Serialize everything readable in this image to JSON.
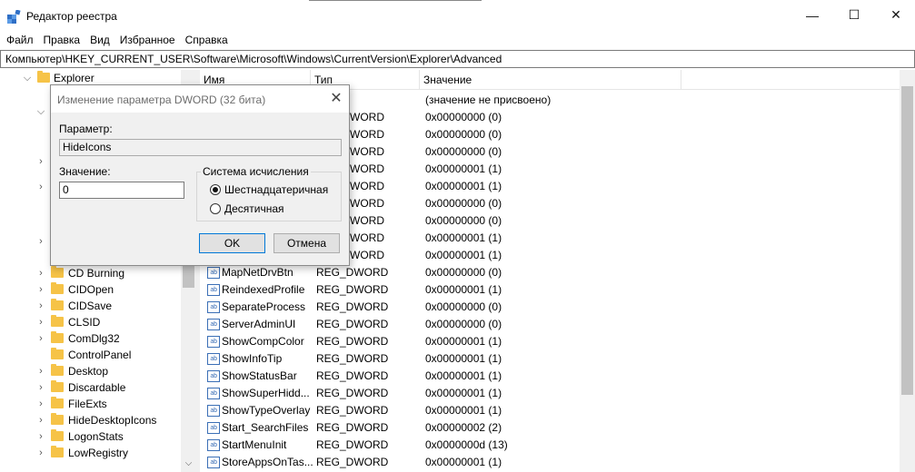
{
  "window": {
    "title": "Редактор реестра",
    "minimize": "—",
    "maximize": "☐",
    "close": "✕"
  },
  "menu": [
    "Файл",
    "Правка",
    "Вид",
    "Избранное",
    "Справка"
  ],
  "address": "Компьютер\\HKEY_CURRENT_USER\\Software\\Microsoft\\Windows\\CurrentVersion\\Explorer\\Advanced",
  "tree": {
    "parent": "Explorer",
    "items": [
      "CD Burning",
      "CIDOpen",
      "CIDSave",
      "CLSID",
      "ComDlg32",
      "ControlPanel",
      "Desktop",
      "Discardable",
      "FileExts",
      "HideDesktopIcons",
      "LogonStats",
      "LowRegistry"
    ]
  },
  "list": {
    "headers": {
      "name": "Имя",
      "type": "Тип",
      "data": "Значение"
    },
    "hidden_rows": [
      {
        "type": "",
        "data": "(значение не присвоено)"
      },
      {
        "type": "WORD",
        "data": "0x00000000 (0)"
      },
      {
        "type": "WORD",
        "data": "0x00000000 (0)"
      },
      {
        "type": "WORD",
        "data": "0x00000000 (0)"
      },
      {
        "type": "WORD",
        "data": "0x00000001 (1)"
      },
      {
        "type": "WORD",
        "data": "0x00000001 (1)"
      },
      {
        "type": "WORD",
        "data": "0x00000000 (0)"
      },
      {
        "type": "WORD",
        "data": "0x00000000 (0)"
      },
      {
        "type": "WORD",
        "data": "0x00000001 (1)"
      },
      {
        "type": "WORD",
        "data": "0x00000001 (1)"
      }
    ],
    "rows": [
      {
        "name": "MapNetDrvBtn",
        "type": "REG_DWORD",
        "data": "0x00000000 (0)"
      },
      {
        "name": "ReindexedProfile",
        "type": "REG_DWORD",
        "data": "0x00000001 (1)"
      },
      {
        "name": "SeparateProcess",
        "type": "REG_DWORD",
        "data": "0x00000000 (0)"
      },
      {
        "name": "ServerAdminUI",
        "type": "REG_DWORD",
        "data": "0x00000000 (0)"
      },
      {
        "name": "ShowCompColor",
        "type": "REG_DWORD",
        "data": "0x00000001 (1)"
      },
      {
        "name": "ShowInfoTip",
        "type": "REG_DWORD",
        "data": "0x00000001 (1)"
      },
      {
        "name": "ShowStatusBar",
        "type": "REG_DWORD",
        "data": "0x00000001 (1)"
      },
      {
        "name": "ShowSuperHidd...",
        "type": "REG_DWORD",
        "data": "0x00000001 (1)"
      },
      {
        "name": "ShowTypeOverlay",
        "type": "REG_DWORD",
        "data": "0x00000001 (1)"
      },
      {
        "name": "Start_SearchFiles",
        "type": "REG_DWORD",
        "data": "0x00000002 (2)"
      },
      {
        "name": "StartMenuInit",
        "type": "REG_DWORD",
        "data": "0x0000000d (13)"
      },
      {
        "name": "StoreAppsOnTas...",
        "type": "REG_DWORD",
        "data": "0x00000001 (1)"
      }
    ],
    "icon_text": "ab"
  },
  "dialog": {
    "title": "Изменение параметра DWORD (32 бита)",
    "param_label": "Параметр:",
    "param_value": "HideIcons",
    "value_label": "Значение:",
    "value": "0",
    "base_group": "Система исчисления",
    "hex_label": "Шестнадцатеричная",
    "dec_label": "Десятичная",
    "selected_base": "hex",
    "ok": "OK",
    "cancel": "Отмена"
  }
}
